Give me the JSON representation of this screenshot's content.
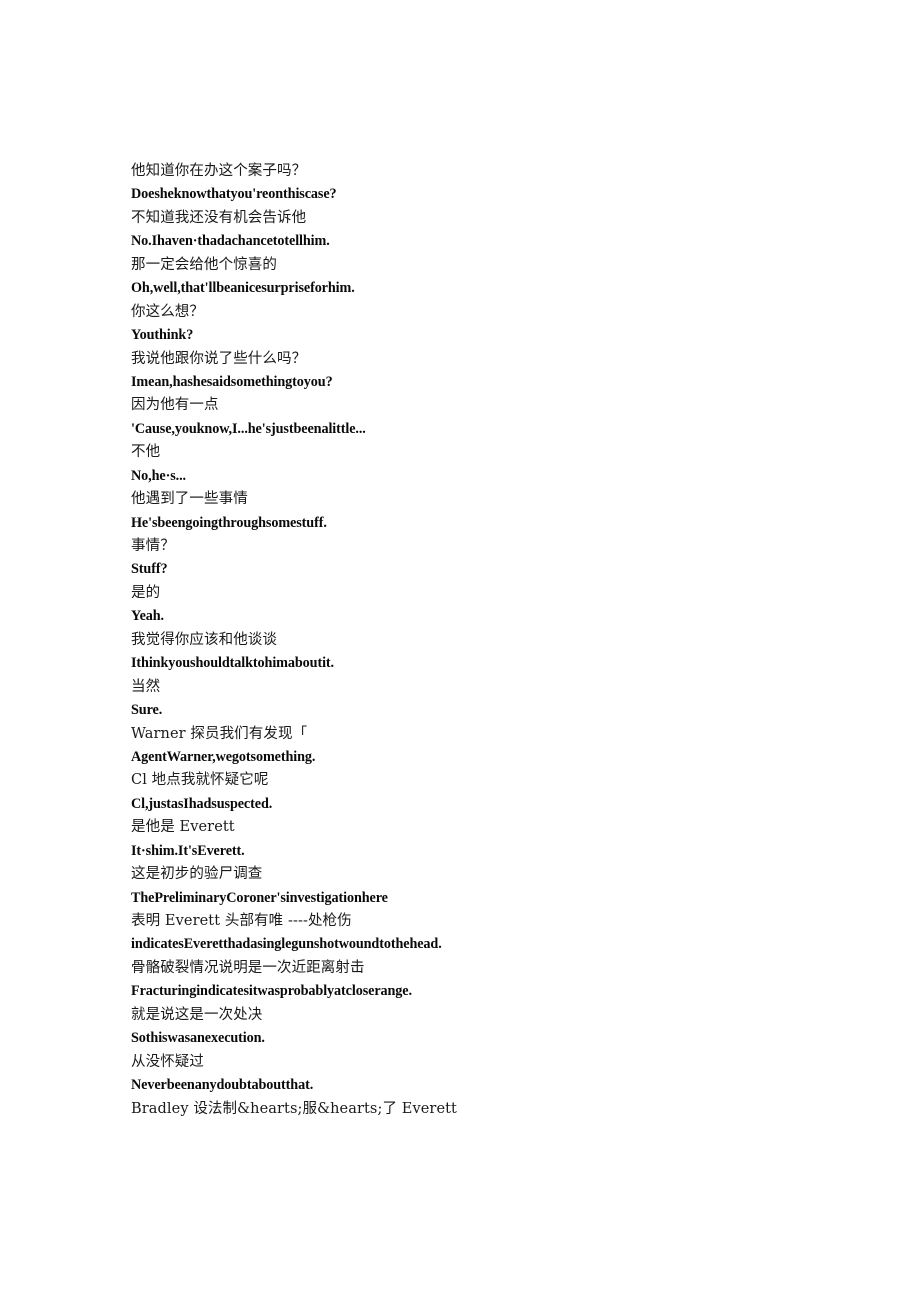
{
  "page": {
    "background_color": "#ffffff",
    "text_color": "#000000",
    "title": "Subtitle Transcript"
  },
  "transcript": {
    "lines": [
      {
        "lang": "zh",
        "text": "他知道你在办这个案子吗？"
      },
      {
        "lang": "en",
        "text": "Doesheknowthatyou'reonthiscase?"
      },
      {
        "lang": "zh",
        "text": "不知道我还没有机会告诉他"
      },
      {
        "lang": "en",
        "text": "No.Ihaven·thadachancetotellhim."
      },
      {
        "lang": "zh",
        "text": "那一定会给他个惊喜的"
      },
      {
        "lang": "en",
        "text": "Oh,well,that'llbeanicesurpriseforhim."
      },
      {
        "lang": "zh",
        "text": "你这么想？"
      },
      {
        "lang": "en",
        "text": "Youthink?"
      },
      {
        "lang": "zh",
        "text": "我说他跟你说了些什么吗？"
      },
      {
        "lang": "en",
        "text": "Imean,hashesaidsomethingtoyou?"
      },
      {
        "lang": "zh",
        "text": "因为他有一点"
      },
      {
        "lang": "en",
        "text": "'Cause,youknow,I...he'sjustbeenalittle..."
      },
      {
        "lang": "zh",
        "text": "不他"
      },
      {
        "lang": "en",
        "text": "No,he·s..."
      },
      {
        "lang": "zh",
        "text": "他遇到了一些事情"
      },
      {
        "lang": "en",
        "text": "He'sbeengoingthroughsomestuff."
      },
      {
        "lang": "zh",
        "text": "事情？"
      },
      {
        "lang": "en",
        "text": "Stuff?"
      },
      {
        "lang": "zh",
        "text": "是的"
      },
      {
        "lang": "en",
        "text": "Yeah."
      },
      {
        "lang": "zh",
        "text": "我觉得你应该和他谈谈"
      },
      {
        "lang": "en",
        "text": "Ithinkyoushouldtalktohimaboutit."
      },
      {
        "lang": "zh",
        "text": "当然"
      },
      {
        "lang": "en",
        "text": "Sure."
      },
      {
        "lang": "zh",
        "text": "Warner 探员我们有发现「"
      },
      {
        "lang": "en",
        "text": "AgentWarner,wegotsomething."
      },
      {
        "lang": "zh",
        "text": "Cl 地点我就怀疑它呢"
      },
      {
        "lang": "en",
        "text": "Cl,justasIhadsuspected."
      },
      {
        "lang": "zh",
        "text": "是他是 Everett"
      },
      {
        "lang": "en",
        "text": "It·shim.It'sEverett."
      },
      {
        "lang": "zh",
        "text": "这是初步的验尸调查"
      },
      {
        "lang": "en",
        "text": "ThePreliminaryCoroner'sinvestigationhere"
      },
      {
        "lang": "zh",
        "text": "表明 Everett 头部有唯 ----处枪伤"
      },
      {
        "lang": "en",
        "text": "indicatesEveretthadasinglegunshotwoundtothehead."
      },
      {
        "lang": "zh",
        "text": "骨骼破裂情况说明是一次近距离射击"
      },
      {
        "lang": "en",
        "text": "Fracturingindicatesitwasprobablyatcloserange."
      },
      {
        "lang": "zh",
        "text": "就是说这是一次处决"
      },
      {
        "lang": "en",
        "text": "Sothiswasanexecution."
      },
      {
        "lang": "zh",
        "text": "从没怀疑过"
      },
      {
        "lang": "en",
        "text": "Neverbeenanydoubtaboutthat."
      },
      {
        "lang": "zh",
        "text": "Bradley 设法制&hearts;服&hearts;了 Everett"
      }
    ]
  }
}
